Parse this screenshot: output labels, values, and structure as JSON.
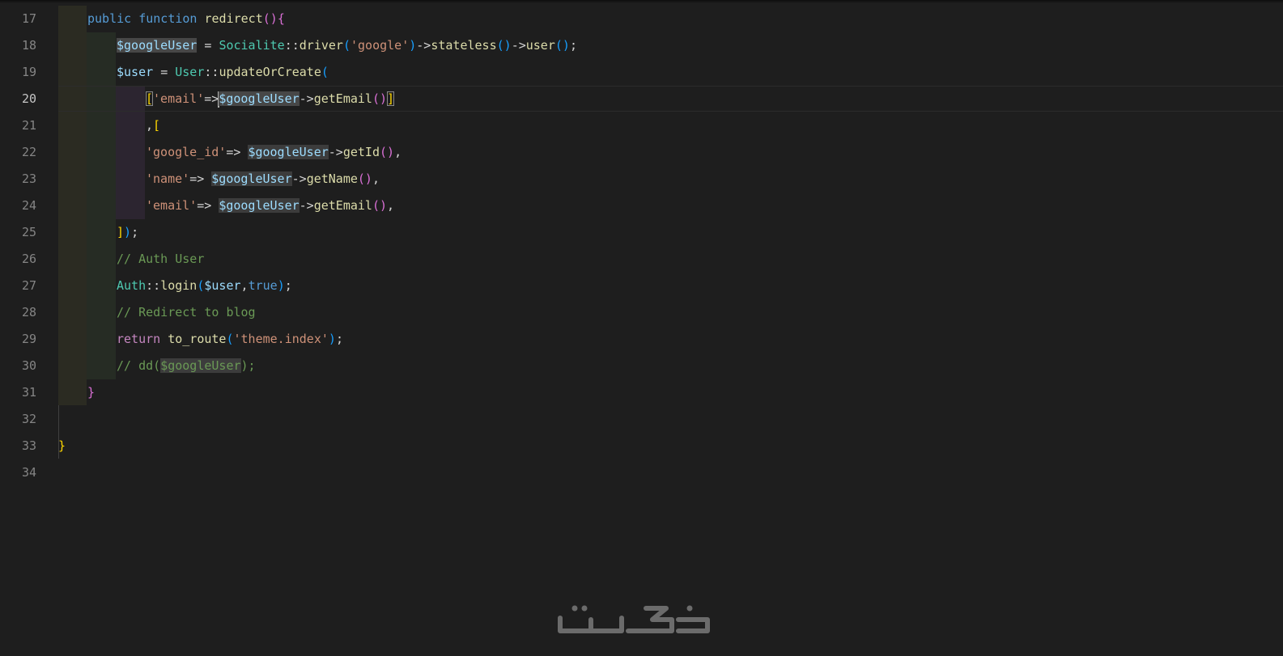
{
  "editor": {
    "line_numbers": [
      "17",
      "18",
      "19",
      "20",
      "21",
      "22",
      "23",
      "24",
      "25",
      "26",
      "27",
      "28",
      "29",
      "30",
      "31",
      "32",
      "33",
      "34"
    ],
    "active_line": "20",
    "tokens": {
      "public": "public",
      "function": "function",
      "redirect": "redirect",
      "googleUser": "$googleUser",
      "user_var": "$user",
      "socialite": "Socialite",
      "driver": "driver",
      "google_str": "'google'",
      "stateless": "stateless",
      "user_fn": "user",
      "user_cls": "User",
      "updateOrCreate": "updateOrCreate",
      "email_key": "'email'",
      "getEmail": "getEmail",
      "google_id_key": "'google_id'",
      "getId": "getId",
      "name_key": "'name'",
      "getName": "getName",
      "auth": "Auth",
      "login": "login",
      "true_kw": "true",
      "return_kw": "return",
      "to_route": "to_route",
      "theme_index": "'theme.index'",
      "comment_auth": "// Auth User",
      "comment_redirect": "// Redirect to blog",
      "comment_dd": "// dd(",
      "comment_dd_end": ");"
    }
  },
  "watermark": {
    "logo_name": "khodesat-logo",
    "color": "#6b6b6b"
  }
}
